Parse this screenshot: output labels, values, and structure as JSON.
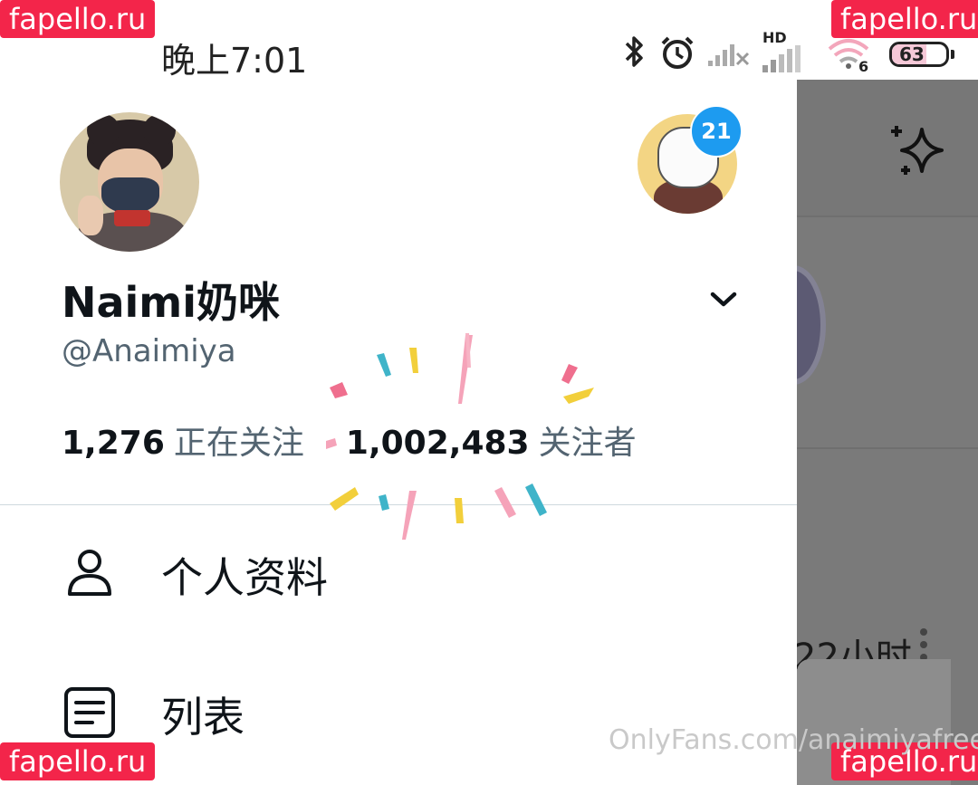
{
  "status_bar": {
    "time": "晚上7:01",
    "network_label": "HD",
    "wifi_label": "6",
    "battery": "63",
    "battery_level": 0.63,
    "icons": [
      "bluetooth-icon",
      "alarm-icon",
      "signal-weak-icon",
      "signal-hd-icon",
      "wifi-icon",
      "battery-icon"
    ]
  },
  "drawer": {
    "display_name": "Naimi奶咪",
    "handle": "@Anaimiya",
    "account_badge": "21",
    "stats": {
      "following_count": "1,276",
      "following_label": "正在关注",
      "followers_count": "1,002,483",
      "followers_label": "关注者"
    },
    "menu": [
      {
        "label": "个人资料",
        "icon": "person-icon"
      },
      {
        "label": "列表",
        "icon": "list-icon"
      }
    ]
  },
  "background_app": {
    "timestamp": "22小时",
    "more_icon": "more-vertical-icon",
    "sparkle_icon": "sparkle-icon"
  },
  "watermarks": {
    "site": "fapello.ru",
    "url": "OnlyFans.com/anaimiyafree"
  },
  "colors": {
    "accent": "#1d9bf0",
    "text_primary": "#0f1419",
    "text_secondary": "#536471",
    "overlay": "#7a7a7a",
    "watermark": "#f3254a"
  }
}
